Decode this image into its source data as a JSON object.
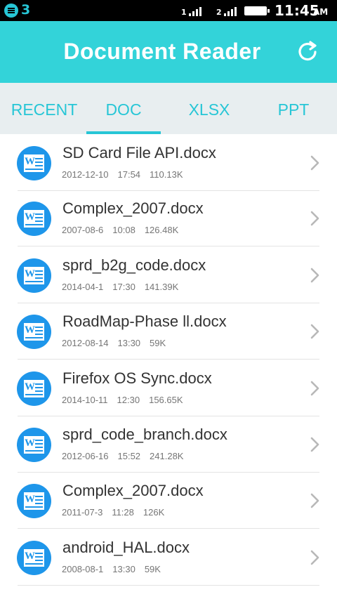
{
  "status_bar": {
    "notification_count": "3",
    "sim1_label": "1",
    "sim2_label": "2",
    "time": "11:45",
    "ampm": "AM"
  },
  "header": {
    "title": "Document Reader",
    "refresh_icon": "refresh-icon"
  },
  "tabs": [
    {
      "label": "RECENT",
      "active": false
    },
    {
      "label": "DOC",
      "active": true
    },
    {
      "label": "XLSX",
      "active": false
    },
    {
      "label": "PPT",
      "active": false
    }
  ],
  "files": [
    {
      "name": "SD Card File API.docx",
      "date": "2012-12-10",
      "time": "17:54",
      "size": "110.13K"
    },
    {
      "name": "Complex_2007.docx",
      "date": "2007-08-6",
      "time": "10:08",
      "size": "126.48K"
    },
    {
      "name": "sprd_b2g_code.docx",
      "date": "2014-04-1",
      "time": "17:30",
      "size": "141.39K"
    },
    {
      "name": "RoadMap-Phase ll.docx",
      "date": "2012-08-14",
      "time": "13:30",
      "size": "59K"
    },
    {
      "name": "Firefox OS Sync.docx",
      "date": "2014-10-11",
      "time": "12:30",
      "size": "156.65K"
    },
    {
      "name": "sprd_code_branch.docx",
      "date": "2012-06-16",
      "time": "15:52",
      "size": "241.28K"
    },
    {
      "name": "Complex_2007.docx",
      "date": "2011-07-3",
      "time": "11:28",
      "size": "126K"
    },
    {
      "name": "android_HAL.docx",
      "date": "2008-08-1",
      "time": "13:30",
      "size": "59K"
    }
  ],
  "colors": {
    "accent": "#33d3d9",
    "tab_text": "#27c6d6",
    "doc_icon": "#1e96ea"
  }
}
